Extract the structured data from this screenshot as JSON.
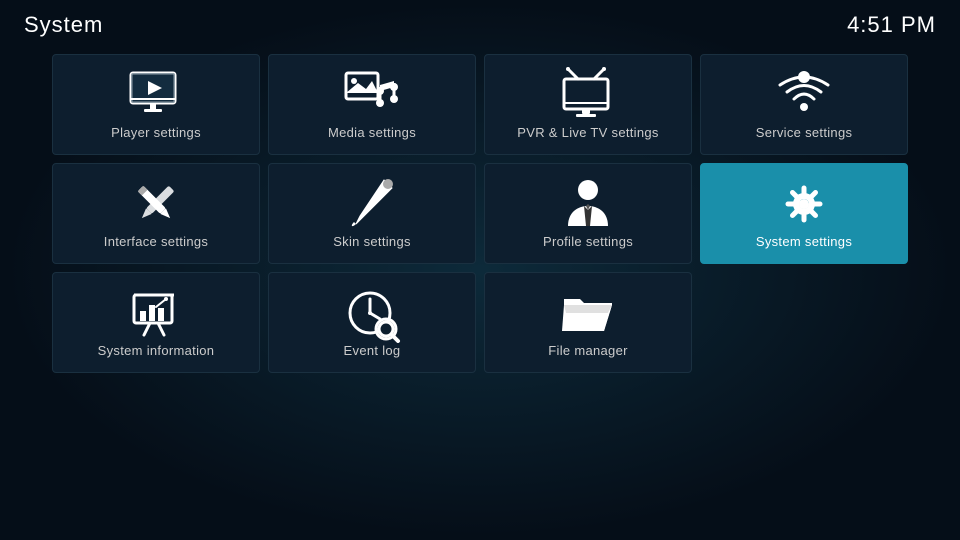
{
  "header": {
    "title": "System",
    "time": "4:51 PM"
  },
  "grid": {
    "items": [
      {
        "id": "player-settings",
        "label": "Player settings",
        "icon": "player",
        "active": false
      },
      {
        "id": "media-settings",
        "label": "Media settings",
        "icon": "media",
        "active": false
      },
      {
        "id": "pvr-settings",
        "label": "PVR & Live TV settings",
        "icon": "pvr",
        "active": false
      },
      {
        "id": "service-settings",
        "label": "Service settings",
        "icon": "service",
        "active": false
      },
      {
        "id": "interface-settings",
        "label": "Interface settings",
        "icon": "interface",
        "active": false
      },
      {
        "id": "skin-settings",
        "label": "Skin settings",
        "icon": "skin",
        "active": false
      },
      {
        "id": "profile-settings",
        "label": "Profile settings",
        "icon": "profile",
        "active": false
      },
      {
        "id": "system-settings",
        "label": "System settings",
        "icon": "system",
        "active": true
      },
      {
        "id": "system-information",
        "label": "System information",
        "icon": "info",
        "active": false
      },
      {
        "id": "event-log",
        "label": "Event log",
        "icon": "eventlog",
        "active": false
      },
      {
        "id": "file-manager",
        "label": "File manager",
        "icon": "filemanager",
        "active": false
      }
    ]
  }
}
